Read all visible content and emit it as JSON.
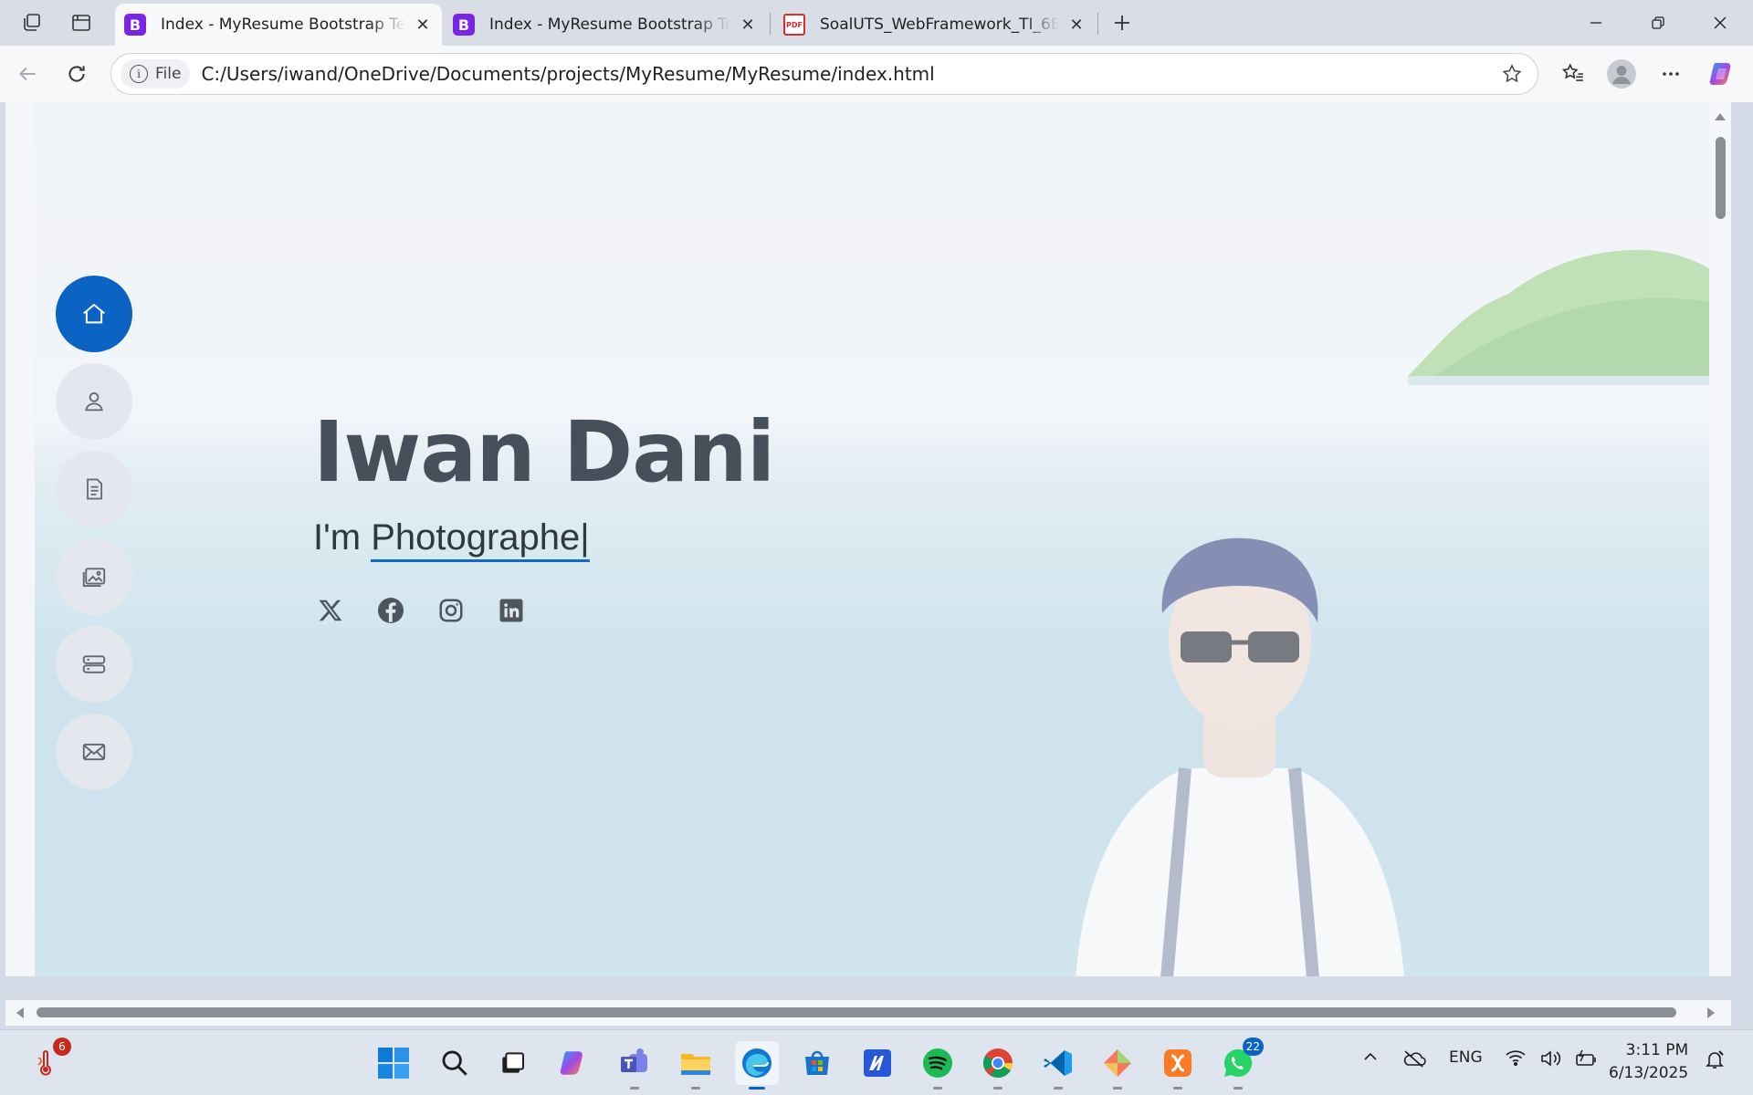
{
  "browser": {
    "tabs": [
      {
        "title": "Index - MyResume Bootstrap Template",
        "favicon": "bootstrap-icon",
        "active": true
      },
      {
        "title": "Index - MyResume Bootstrap Template",
        "favicon": "bootstrap-icon",
        "active": false
      },
      {
        "title": "SoalUTS_WebFramework_TI_6B (1).pdf",
        "favicon": "pdf-icon",
        "active": false
      }
    ],
    "favicon_letter": "B",
    "pdf_letter": "PDF",
    "site_chip": "File",
    "url": "C:/Users/iwand/OneDrive/Documents/projects/MyResume/MyResume/index.html"
  },
  "page": {
    "name": "Iwan Dani",
    "subtitle_prefix": "I'm",
    "typed_text": "Photographe|",
    "nav": [
      {
        "icon": "home-icon",
        "active": true
      },
      {
        "icon": "person-icon",
        "active": false
      },
      {
        "icon": "file-text-icon",
        "active": false
      },
      {
        "icon": "images-icon",
        "active": false
      },
      {
        "icon": "server-icon",
        "active": false
      },
      {
        "icon": "envelope-icon",
        "active": false
      }
    ],
    "social": [
      "x-twitter-icon",
      "facebook-icon",
      "instagram-icon",
      "linkedin-icon"
    ],
    "colors": {
      "accent": "#0b63c4",
      "name": "#45505b"
    }
  },
  "taskbar": {
    "weather_badge": "6",
    "whatsapp_badge": "22",
    "language": "ENG",
    "time": "3:11 PM",
    "date": "6/13/2025",
    "apps": [
      "start-icon",
      "search-icon",
      "task-view-icon",
      "copilot-icon",
      "teams-icon",
      "file-explorer-icon",
      "edge-icon",
      "store-icon",
      "ms-app-icon",
      "spotify-icon",
      "chrome-icon",
      "vscode-icon",
      "git-icon",
      "xampp-icon",
      "whatsapp-icon"
    ]
  }
}
